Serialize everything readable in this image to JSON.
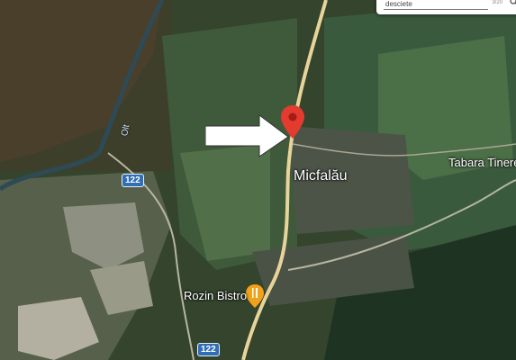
{
  "map": {
    "place_labels": {
      "town": "Micfalău",
      "campsite": "Tabara Tinere",
      "restaurant": "Rozin Bistro",
      "river": "Olt"
    },
    "road_shields": [
      "122",
      "122"
    ],
    "search": {
      "query": "desciete",
      "count": "3/20"
    },
    "icons": {
      "pin": "map-pin-icon",
      "restaurant": "fork-knife-icon",
      "search": "search-icon",
      "arrow": "arrow-right-icon"
    },
    "colors": {
      "pin_red": "#e33b2e",
      "restaurant_orange": "#f2a11a",
      "shield_blue": "#2f6fb5",
      "road_yellow": "#e8d49a"
    }
  }
}
